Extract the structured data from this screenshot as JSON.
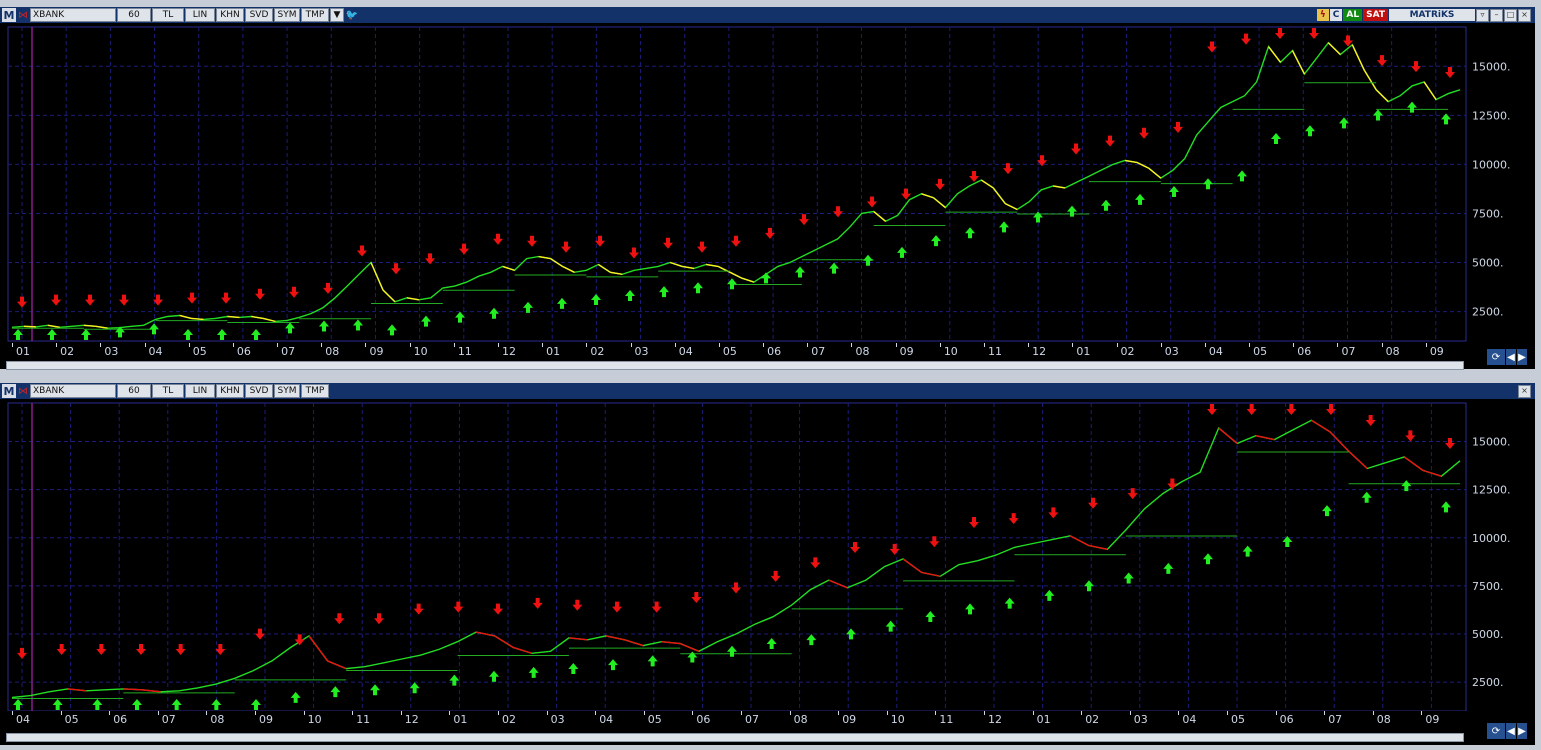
{
  "panes": [
    {
      "toolbar": {
        "symbol": "XBANK",
        "period": "60",
        "currency": "TL",
        "buttons": [
          "LIN",
          "KHN",
          "SVD",
          "SYM",
          "TMP"
        ],
        "right": {
          "c": "C",
          "buy": "AL",
          "sell": "SAT",
          "brand": "MATRiKS"
        }
      }
    },
    {
      "toolbar": {
        "symbol": "XBANK",
        "period": "60",
        "currency": "TL",
        "buttons": [
          "LIN",
          "KHN",
          "SVD",
          "SYM",
          "TMP"
        ]
      }
    }
  ],
  "colors": {
    "price_up": "#22dd22",
    "price_alt_top": "#ffee22",
    "price_alt_bottom": "#ee1111",
    "buy_arrow": "#22ee22",
    "sell_arrow": "#ee1111",
    "grid": "#1c1c7a",
    "axis_text": "#cfd8e8",
    "title_bar": "#13326a"
  },
  "chart_data": [
    {
      "type": "line",
      "ylim": [
        1000,
        17000
      ],
      "yticks": [
        "15000.",
        "12500.",
        "10000.",
        "7500.",
        "5000.",
        "2500."
      ],
      "ytick_values": [
        15000,
        12500,
        10000,
        7500,
        5000,
        2500
      ],
      "x_labels": [
        "01",
        "02",
        "03",
        "04",
        "05",
        "06",
        "07",
        "08",
        "09",
        "10",
        "11",
        "12",
        "01",
        "02",
        "03",
        "04",
        "05",
        "06",
        "07",
        "08",
        "09",
        "10",
        "11",
        "12",
        "01",
        "02",
        "03",
        "04",
        "05",
        "06",
        "07",
        "08",
        "09"
      ],
      "series": [
        {
          "values": [
            1700,
            1750,
            1720,
            1800,
            1700,
            1750,
            1800,
            1750,
            1650,
            1680,
            1750,
            1800,
            2100,
            2250,
            2300,
            2150,
            2100,
            2150,
            2250,
            2200,
            2250,
            2150,
            2000,
            2050,
            2200,
            2400,
            2700,
            3200,
            3800,
            4400,
            5000,
            3600,
            3000,
            3200,
            3100,
            3200,
            3700,
            3800,
            4000,
            4300,
            4500,
            4800,
            4600,
            5200,
            5300,
            5200,
            4800,
            4500,
            4600,
            4900,
            4500,
            4400,
            4600,
            4700,
            4800,
            5000,
            4800,
            4700,
            4900,
            4800,
            4500,
            4200,
            4000,
            4400,
            4800,
            5000,
            5300,
            5600,
            5900,
            6200,
            6800,
            7500,
            7600,
            7100,
            7400,
            8200,
            8500,
            8300,
            7800,
            8500,
            8900,
            9200,
            8800,
            8000,
            7700,
            8100,
            8700,
            8900,
            8800,
            9100,
            9400,
            9700,
            10000,
            10200,
            10100,
            9800,
            9300,
            9700,
            10300,
            11500,
            12200,
            12900,
            13200,
            13500,
            14200,
            16000,
            15200,
            15800,
            14600,
            15400,
            16200,
            15600,
            16100,
            14800,
            13800,
            13200,
            13500,
            14000,
            14200,
            13300,
            13600,
            13800
          ]
        },
        {
          "values": []
        }
      ],
      "buy_signals": [
        1700,
        1700,
        1700,
        1950,
        2100,
        1550,
        1650,
        1600,
        2150,
        2250,
        2300,
        2050,
        2500,
        2700,
        2900,
        3200,
        3400,
        3600,
        3800,
        4000,
        4200,
        4400,
        4700,
        5000,
        5200,
        5600,
        6000,
        6600,
        7000,
        7300,
        7800,
        8100,
        8400,
        8700,
        9100,
        9500,
        9900,
        11800,
        12200,
        12600,
        13000,
        13400,
        12800
      ],
      "sell_signals": [
        2500,
        2600,
        2600,
        2600,
        2600,
        2700,
        2700,
        2900,
        3000,
        3200,
        5100,
        4200,
        4700,
        5200,
        5700,
        5600,
        5300,
        5600,
        5000,
        5500,
        5300,
        5600,
        6000,
        6700,
        7100,
        7600,
        8000,
        8500,
        8900,
        9300,
        9700,
        10300,
        10700,
        11100,
        11400,
        15500,
        15900,
        16300,
        16400,
        15800,
        14800,
        14500,
        14200
      ]
    },
    {
      "type": "line",
      "ylim": [
        1000,
        17000
      ],
      "yticks": [
        "15000.",
        "12500.",
        "10000.",
        "7500.",
        "5000.",
        "2500."
      ],
      "ytick_values": [
        15000,
        12500,
        10000,
        7500,
        5000,
        2500
      ],
      "x_labels": [
        "04",
        "05",
        "06",
        "07",
        "08",
        "09",
        "10",
        "11",
        "12",
        "01",
        "02",
        "03",
        "04",
        "05",
        "06",
        "07",
        "08",
        "09",
        "10",
        "11",
        "12",
        "01",
        "02",
        "03",
        "04",
        "05",
        "06",
        "07",
        "08",
        "09"
      ],
      "series": [
        {
          "values": [
            1700,
            1800,
            2000,
            2150,
            2050,
            2100,
            2150,
            2100,
            2000,
            2050,
            2200,
            2400,
            2700,
            3100,
            3600,
            4300,
            4900,
            3600,
            3200,
            3300,
            3500,
            3700,
            3900,
            4200,
            4600,
            5100,
            4900,
            4300,
            4000,
            4100,
            4800,
            4700,
            4900,
            4700,
            4400,
            4600,
            4500,
            4100,
            4600,
            5000,
            5500,
            5900,
            6500,
            7300,
            7800,
            7400,
            7800,
            8500,
            8900,
            8200,
            8000,
            8600,
            8800,
            9100,
            9500,
            9700,
            9900,
            10100,
            9600,
            9400,
            10400,
            11500,
            12300,
            12900,
            13400,
            15700,
            14900,
            15300,
            15100,
            15600,
            16100,
            15500,
            14500,
            13600,
            13900,
            14200,
            13500,
            13200,
            14000
          ]
        }
      ],
      "buy_signals": [
        1400,
        1400,
        1400,
        1500,
        1500,
        1300,
        1300,
        2200,
        2500,
        2600,
        2700,
        3100,
        3300,
        3500,
        3700,
        3900,
        4100,
        4300,
        4600,
        5000,
        5200,
        5500,
        5900,
        6400,
        6800,
        7100,
        7500,
        8000,
        8400,
        8900,
        9400,
        9800,
        10300,
        11900,
        12600,
        13200,
        12100
      ],
      "sell_signals": [
        3500,
        3700,
        3700,
        3700,
        3700,
        3700,
        4500,
        4200,
        5300,
        5300,
        5800,
        5900,
        5800,
        6100,
        6000,
        5900,
        5900,
        6400,
        6900,
        7500,
        8200,
        9000,
        8900,
        9300,
        10300,
        10500,
        10800,
        11300,
        11800,
        12300,
        16200,
        16600,
        16700,
        16600,
        15600,
        14800,
        14400
      ]
    }
  ]
}
